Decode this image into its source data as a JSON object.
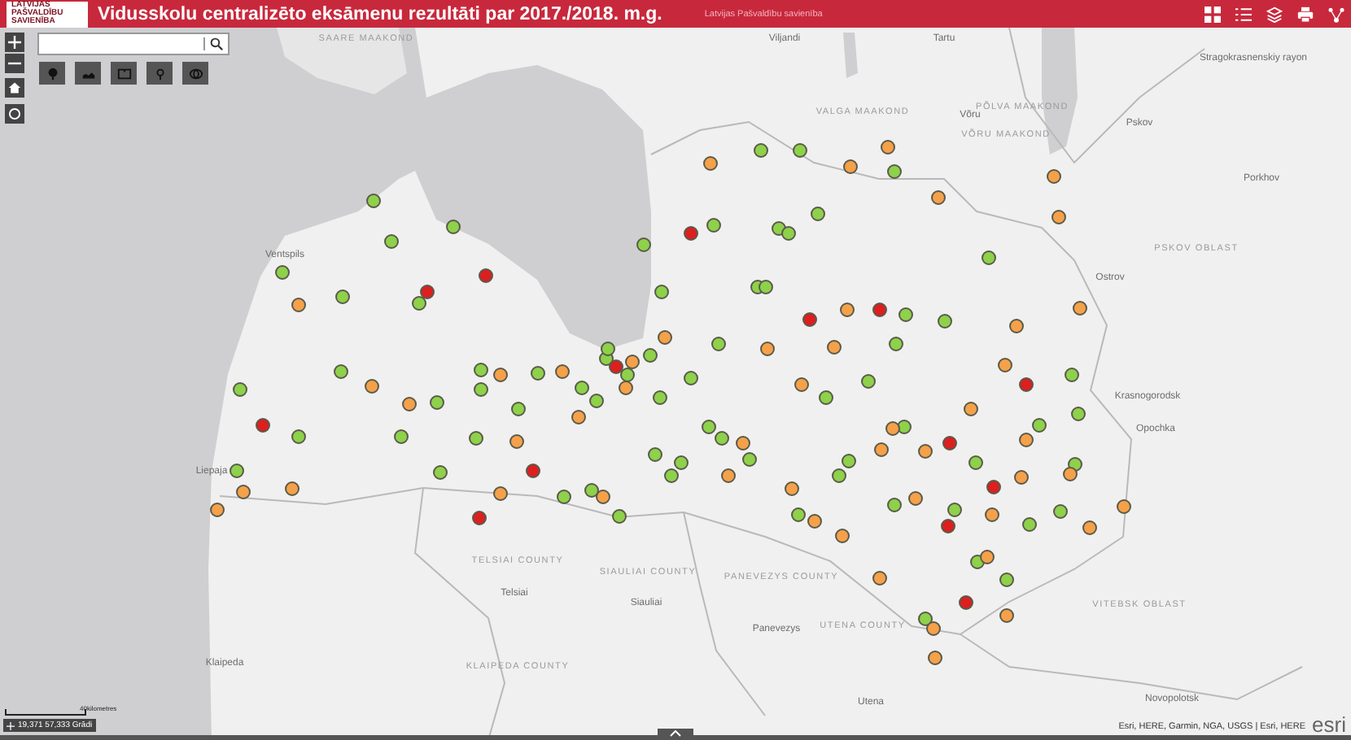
{
  "header": {
    "logo_text": "LATVIJAS PAŠVALDĪBU SAVIENĪBA",
    "title": "Vidusskolu centralizēto eksāmenu rezultāti par 2017./2018. m.g.",
    "subtitle": "Latvijas Pašvaldību savienība"
  },
  "map": {
    "labels": [
      {
        "text": "SAARE MAAKOND",
        "kind": "region"
      },
      {
        "text": "Viljandi",
        "kind": "place"
      },
      {
        "text": "Tartu",
        "kind": "place"
      },
      {
        "text": "Stragokrasnenskiy rayon",
        "kind": "place"
      },
      {
        "text": "VALGA MAAKOND",
        "kind": "region"
      },
      {
        "text": "PÕLVA MAAKOND",
        "kind": "region"
      },
      {
        "text": "Võru",
        "kind": "place"
      },
      {
        "text": "VÕRU MAAKOND",
        "kind": "region"
      },
      {
        "text": "Pskov",
        "kind": "place"
      },
      {
        "text": "Porkhov",
        "kind": "place"
      },
      {
        "text": "PSKOV OBLAST",
        "kind": "region"
      },
      {
        "text": "Ostrov",
        "kind": "place"
      },
      {
        "text": "Krasnogorodsk",
        "kind": "place"
      },
      {
        "text": "Opochka",
        "kind": "place"
      },
      {
        "text": "Ventspils",
        "kind": "place"
      },
      {
        "text": "Liepaja",
        "kind": "place"
      },
      {
        "text": "TELSIAI COUNTY",
        "kind": "region"
      },
      {
        "text": "Telsiai",
        "kind": "place"
      },
      {
        "text": "SIAULIAI COUNTY",
        "kind": "region"
      },
      {
        "text": "Siauliai",
        "kind": "place"
      },
      {
        "text": "PANEVEZYS COUNTY",
        "kind": "region"
      },
      {
        "text": "Panevezys",
        "kind": "place"
      },
      {
        "text": "UTENA COUNTY",
        "kind": "region"
      },
      {
        "text": "Utena",
        "kind": "place"
      },
      {
        "text": "VITEBSK OBLAST",
        "kind": "region"
      },
      {
        "text": "Klaipeda",
        "kind": "place"
      },
      {
        "text": "KLAIPEDA COUNTY",
        "kind": "region"
      },
      {
        "text": "Novopolotsk",
        "kind": "place"
      }
    ],
    "dots": [
      {
        "color": "#8ed14a"
      },
      {
        "color": "#f5a14a"
      },
      {
        "color": "#8ed14a"
      },
      {
        "color": "#f5a14a"
      },
      {
        "color": "#f5a14a"
      },
      {
        "color": "#8ed14a"
      },
      {
        "color": "#dc1f1f"
      },
      {
        "color": "#8ed14a"
      },
      {
        "color": "#8ed14a"
      },
      {
        "color": "#8ed14a"
      },
      {
        "color": "#8ed14a"
      },
      {
        "color": "#f5a14a"
      },
      {
        "color": "#f5a14a"
      },
      {
        "color": "#8ed14a"
      },
      {
        "color": "#f5a14a"
      },
      {
        "color": "#8ed14a"
      },
      {
        "color": "#8ed14a"
      },
      {
        "color": "#8ed14a"
      },
      {
        "color": "#dc1f1f"
      },
      {
        "color": "#dc1f1f"
      },
      {
        "color": "#8ed14a"
      },
      {
        "color": "#8ed14a"
      },
      {
        "color": "#f5a14a"
      },
      {
        "color": "#8ed14a"
      },
      {
        "color": "#8ed14a"
      },
      {
        "color": "#8ed14a"
      },
      {
        "color": "#8ed14a"
      },
      {
        "color": "#dc1f1f"
      },
      {
        "color": "#dc1f1f"
      },
      {
        "color": "#f5a14a"
      },
      {
        "color": "#8ed14a"
      },
      {
        "color": "#8ed14a"
      },
      {
        "color": "#f5a14a"
      },
      {
        "color": "#f5a14a"
      },
      {
        "color": "#8ed14a"
      },
      {
        "color": "#f5a14a"
      },
      {
        "color": "#dc1f1f"
      },
      {
        "color": "#8ed14a"
      },
      {
        "color": "#f5a14a"
      },
      {
        "color": "#f5a14a"
      },
      {
        "color": "#8ed14a"
      },
      {
        "color": "#8ed14a"
      },
      {
        "color": "#f5a14a"
      },
      {
        "color": "#8ed14a"
      },
      {
        "color": "#8ed14a"
      },
      {
        "color": "#dc1f1f"
      },
      {
        "color": "#8ed14a"
      },
      {
        "color": "#8ed14a"
      },
      {
        "color": "#f5a14a"
      },
      {
        "color": "#f5a14a"
      },
      {
        "color": "#8ed14a"
      },
      {
        "color": "#8ed14a"
      },
      {
        "color": "#f5a14a"
      },
      {
        "color": "#8ed14a"
      },
      {
        "color": "#8ed14a"
      },
      {
        "color": "#f5a14a"
      },
      {
        "color": "#8ed14a"
      },
      {
        "color": "#8ed14a"
      },
      {
        "color": "#dc1f1f"
      },
      {
        "color": "#8ed14a"
      },
      {
        "color": "#8ed14a"
      },
      {
        "color": "#f5a14a"
      },
      {
        "color": "#8ed14a"
      },
      {
        "color": "#f5a14a"
      },
      {
        "color": "#8ed14a"
      },
      {
        "color": "#f5a14a"
      },
      {
        "color": "#8ed14a"
      },
      {
        "color": "#8ed14a"
      },
      {
        "color": "#8ed14a"
      },
      {
        "color": "#f5a14a"
      },
      {
        "color": "#f5a14a"
      },
      {
        "color": "#8ed14a"
      },
      {
        "color": "#f5a14a"
      },
      {
        "color": "#dc1f1f"
      },
      {
        "color": "#8ed14a"
      },
      {
        "color": "#8ed14a"
      },
      {
        "color": "#8ed14a"
      },
      {
        "color": "#f5a14a"
      },
      {
        "color": "#8ed14a"
      },
      {
        "color": "#8ed14a"
      },
      {
        "color": "#8ed14a"
      },
      {
        "color": "#8ed14a"
      },
      {
        "color": "#f5a14a"
      },
      {
        "color": "#8ed14a"
      },
      {
        "color": "#f5a14a"
      },
      {
        "color": "#8ed14a"
      },
      {
        "color": "#8ed14a"
      },
      {
        "color": "#8ed14a"
      },
      {
        "color": "#f5a14a"
      },
      {
        "color": "#dc1f1f"
      },
      {
        "color": "#f5a14a"
      },
      {
        "color": "#8ed14a"
      },
      {
        "color": "#dc1f1f"
      },
      {
        "color": "#f5a14a"
      },
      {
        "color": "#f5a14a"
      },
      {
        "color": "#8ed14a"
      },
      {
        "color": "#8ed14a"
      },
      {
        "color": "#8ed14a"
      },
      {
        "color": "#f5a14a"
      },
      {
        "color": "#f5a14a"
      },
      {
        "color": "#f5a14a"
      },
      {
        "color": "#8ed14a"
      },
      {
        "color": "#8ed14a"
      },
      {
        "color": "#f5a14a"
      },
      {
        "color": "#8ed14a"
      },
      {
        "color": "#f5a14a"
      },
      {
        "color": "#f5a14a"
      },
      {
        "color": "#8ed14a"
      },
      {
        "color": "#f5a14a"
      },
      {
        "color": "#dc1f1f"
      },
      {
        "color": "#8ed14a"
      },
      {
        "color": "#f5a14a"
      },
      {
        "color": "#8ed14a"
      },
      {
        "color": "#8ed14a"
      },
      {
        "color": "#f5a14a"
      },
      {
        "color": "#f5a14a"
      },
      {
        "color": "#f5a14a"
      },
      {
        "color": "#8ed14a"
      },
      {
        "color": "#f5a14a"
      },
      {
        "color": "#8ed14a"
      },
      {
        "color": "#f5a14a"
      },
      {
        "color": "#8ed14a"
      },
      {
        "color": "#dc1f1f"
      },
      {
        "color": "#f5a14a"
      },
      {
        "color": "#f5a14a"
      },
      {
        "color": "#8ed14a"
      },
      {
        "color": "#f5a14a"
      },
      {
        "color": "#f5a14a"
      },
      {
        "color": "#dc1f1f"
      },
      {
        "color": "#8ed14a"
      },
      {
        "color": "#f5a14a"
      },
      {
        "color": "#8ed14a"
      }
    ]
  },
  "scale": {
    "label": "40kilometres"
  },
  "coordinates": "19,371 57,333 Grādi",
  "attribution": "Esri, HERE, Garmin, NGA, USGS | Esri, HERE",
  "logo": "esri"
}
